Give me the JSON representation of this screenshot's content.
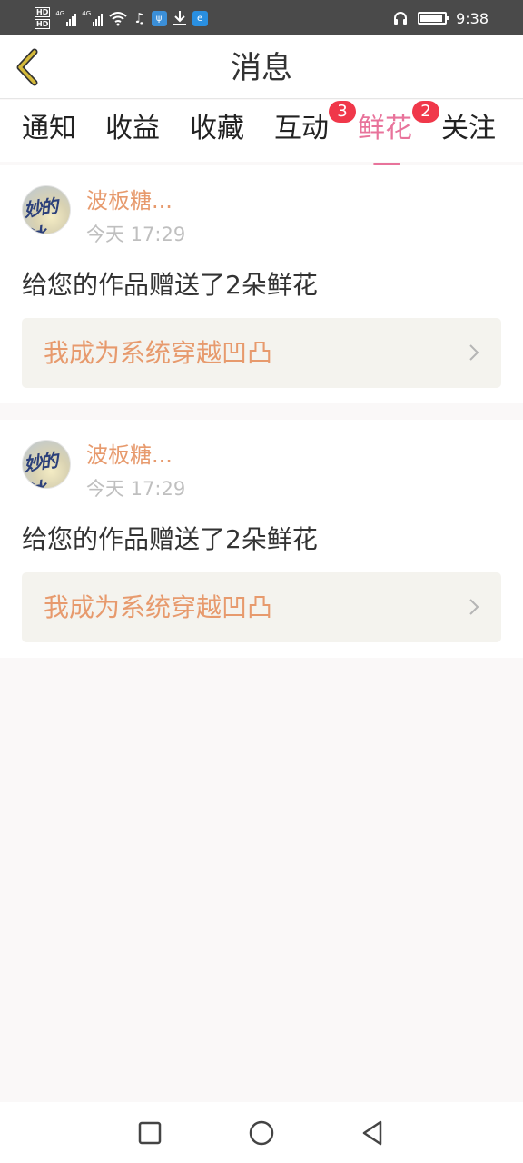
{
  "status_bar": {
    "hd_labels": [
      "HD",
      "HD"
    ],
    "network_labels": [
      "4G",
      "4G"
    ],
    "time": "9:38",
    "icons": [
      "hd-icon",
      "signal-icon",
      "wifi-icon",
      "music-icon",
      "app-icon",
      "download-icon",
      "browser-icon",
      "headset-icon",
      "battery-icon"
    ]
  },
  "header": {
    "title": "消息",
    "back_icon": "chevron-left-icon"
  },
  "tabs": [
    {
      "label": "通知",
      "badge": ""
    },
    {
      "label": "收益",
      "badge": ""
    },
    {
      "label": "收藏",
      "badge": ""
    },
    {
      "label": "互动",
      "badge": "3"
    },
    {
      "label": "鲜花",
      "badge": "2",
      "active": true
    },
    {
      "label": "关注",
      "badge": ""
    }
  ],
  "messages": [
    {
      "avatar_text": "妙的冰",
      "username": "波板糖...",
      "time": "今天 17:29",
      "text": "给您的作品赠送了2朵鲜花",
      "work_title": "我成为系统穿越凹凸"
    },
    {
      "avatar_text": "妙的冰",
      "username": "波板糖...",
      "time": "今天 17:29",
      "text": "给您的作品赠送了2朵鲜花",
      "work_title": "我成为系统穿越凹凸"
    }
  ],
  "nav": {
    "icons": [
      "square-icon",
      "circle-icon",
      "triangle-back-icon"
    ]
  },
  "colors": {
    "accent_pink": "#e8739b",
    "badge_red": "#f0384a",
    "name_orange": "#e79a6d",
    "status_bar_bg": "#4a4a4a",
    "back_arrow_yellow": "#d4b93a"
  }
}
